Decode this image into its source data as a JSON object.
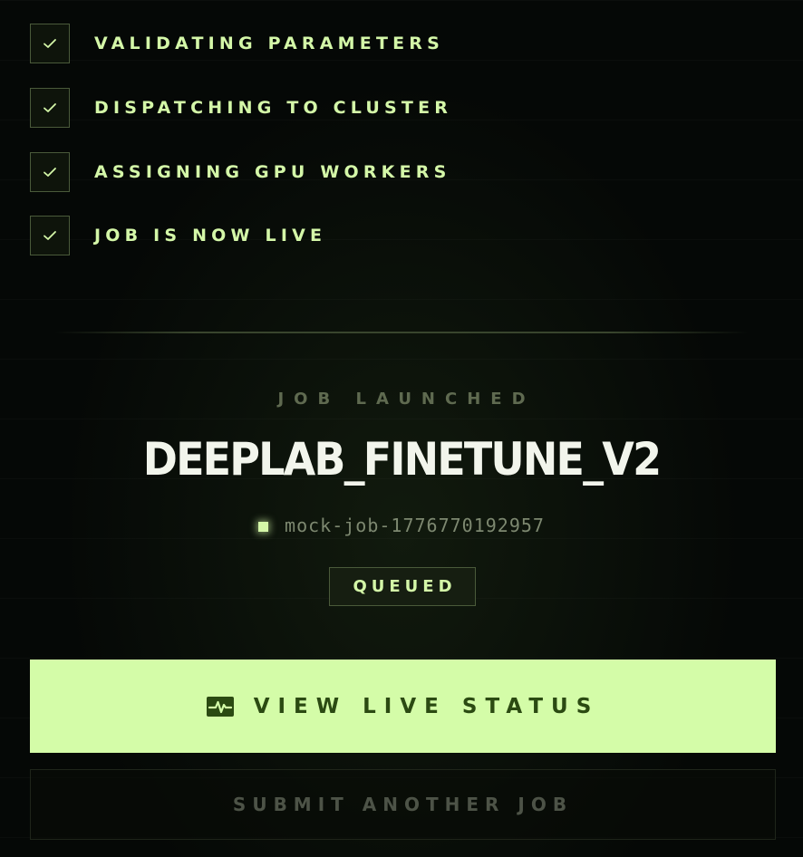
{
  "steps": [
    {
      "label": "VALIDATING PARAMETERS",
      "done": true
    },
    {
      "label": "DISPATCHING TO CLUSTER",
      "done": true
    },
    {
      "label": "ASSIGNING GPU WORKERS",
      "done": true
    },
    {
      "label": "JOB IS NOW LIVE",
      "done": true
    }
  ],
  "result": {
    "heading": "JOB LAUNCHED",
    "job_name": "DEEPLAB_FINETUNE_V2",
    "job_id": "mock-job-1776770192957",
    "status": "QUEUED"
  },
  "actions": {
    "view_status_label": "VIEW LIVE STATUS",
    "view_status_icon": "activity-pulse-icon",
    "submit_another_label": "SUBMIT ANOTHER JOB"
  },
  "colors": {
    "background": "#050806",
    "accent": "#d4fca8",
    "accent_text": "#2b4a12",
    "step_text": "#d4f7a8",
    "muted_text": "#5f6a50"
  }
}
